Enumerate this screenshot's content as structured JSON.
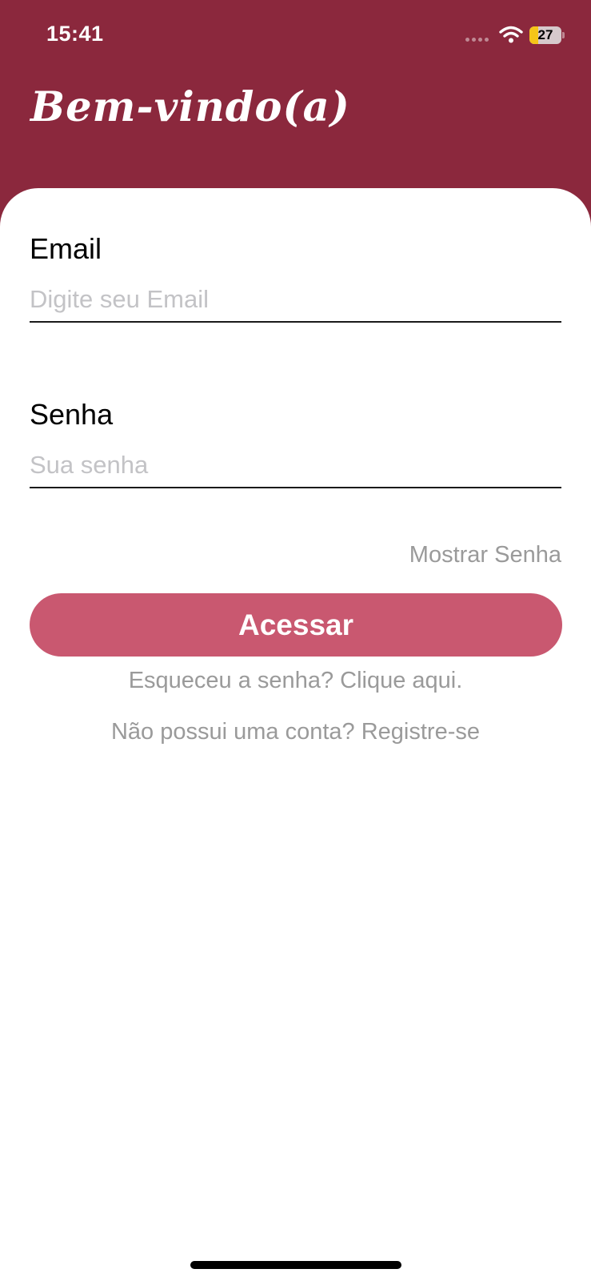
{
  "status_bar": {
    "time": "15:41",
    "battery_level": "27",
    "battery_fraction": 0.27,
    "icons": [
      "signal-icon",
      "wifi-icon",
      "battery-icon"
    ]
  },
  "header": {
    "title": "Bem-vindo(a)"
  },
  "form": {
    "email": {
      "label": "Email",
      "placeholder": "Digite seu Email",
      "value": ""
    },
    "password": {
      "label": "Senha",
      "placeholder": "Sua senha",
      "value": ""
    },
    "show_password_label": "Mostrar Senha",
    "submit_label": "Acessar"
  },
  "links": {
    "forgot_password": "Esqueceu a senha? Clique aqui.",
    "register": "Não possui uma conta? Registre-se"
  },
  "colors": {
    "header_background": "#8B283D",
    "button_background": "#C95870",
    "link_text": "#9A9A9A",
    "placeholder_text": "#C3C3C6",
    "battery_fill": "#F5C518"
  }
}
